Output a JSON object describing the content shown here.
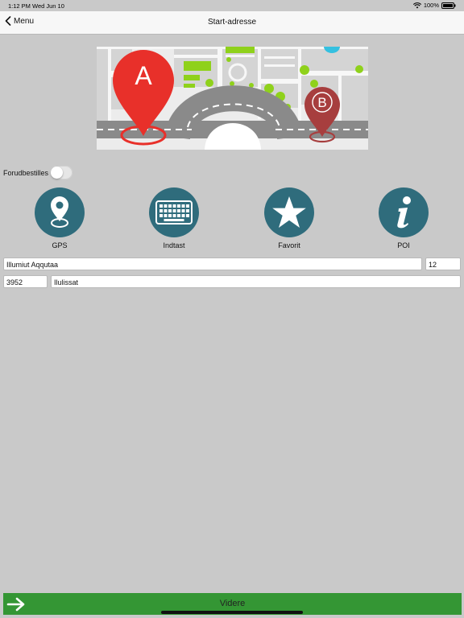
{
  "status": {
    "time": "1:12 PM",
    "date": "Wed Jun 10",
    "battery": "100%"
  },
  "nav": {
    "back_label": "Menu",
    "title": "Start-adresse"
  },
  "hero": {
    "pin_a": "A",
    "pin_b": "B"
  },
  "toggle": {
    "label": "Forudbestilles",
    "on": false
  },
  "options": [
    {
      "label": "GPS",
      "icon": "location-pin-icon"
    },
    {
      "label": "Indtast",
      "icon": "keyboard-icon"
    },
    {
      "label": "Favorit",
      "icon": "star-icon"
    },
    {
      "label": "POI",
      "icon": "info-icon"
    }
  ],
  "address": {
    "street": "Illumiut Aqqutaa",
    "number": "12",
    "postal": "3952",
    "city": "Ilulissat"
  },
  "bottom": {
    "label": "Videre"
  },
  "colors": {
    "accent": "#2f6c7c",
    "green": "#349634",
    "pin_a": "#e8302a",
    "pin_b": "#a73e3e",
    "map_green": "#8fd11b"
  }
}
